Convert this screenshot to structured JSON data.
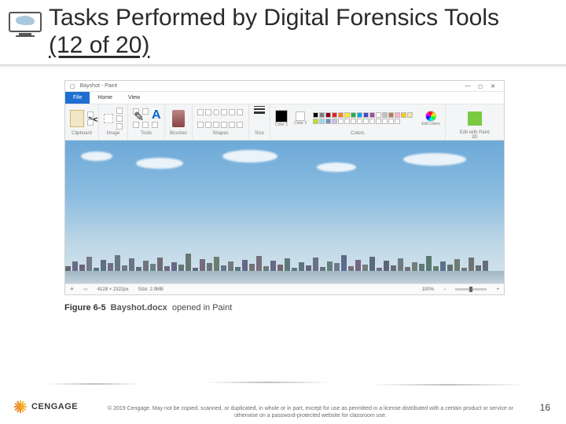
{
  "header": {
    "title": "Tasks Performed by Digital Forensics Tools",
    "subtitle": "(12 of 20)"
  },
  "monitor_icon_name": "monitor-cloud-icon",
  "paint": {
    "title": "Bayshot - Paint",
    "tabs": {
      "file": "File",
      "home": "Home",
      "view": "View"
    },
    "groups": {
      "clipboard": "Clipboard",
      "image": "Image",
      "tools": "Tools",
      "brushes": "Brushes",
      "shapes": "Shapes",
      "size": "Size",
      "colors": "Colors",
      "edit3d": "Edit with Paint 3D"
    },
    "color_labels": {
      "c1": "Color 1",
      "c2": "Color 2",
      "edit": "Edit colors"
    },
    "swatch_colors": [
      "#000000",
      "#7f7f7f",
      "#880015",
      "#ed1c24",
      "#ff7f27",
      "#fff200",
      "#22b14c",
      "#00a2e8",
      "#3f48cc",
      "#a349a4",
      "#ffffff",
      "#c3c3c3",
      "#b97a57",
      "#ffaec9",
      "#ffc90e",
      "#efe4b0",
      "#b5e61d",
      "#99d9ea",
      "#7092be",
      "#c8bfe7",
      "#ffffff",
      "#ffffff",
      "#ffffff",
      "#ffffff",
      "#ffffff",
      "#ffffff",
      "#ffffff",
      "#ffffff",
      "#ffffff",
      "#ffffff"
    ],
    "status": {
      "dims": "4128 × 2322px",
      "size": "Size: 2.9MB",
      "zoom": "100%"
    }
  },
  "figure": {
    "number": "Figure 6-5",
    "filename": "Bayshot.docx",
    "rest": "opened in Paint"
  },
  "footer": {
    "brand": "CENGAGE",
    "copyright": "© 2019 Cengage. May not be copied, scanned, or duplicated, in whole or in part, except for use as permitted in a license distributed with a certain product or service or otherwise on a password-protected website for classroom use.",
    "page": "16"
  }
}
